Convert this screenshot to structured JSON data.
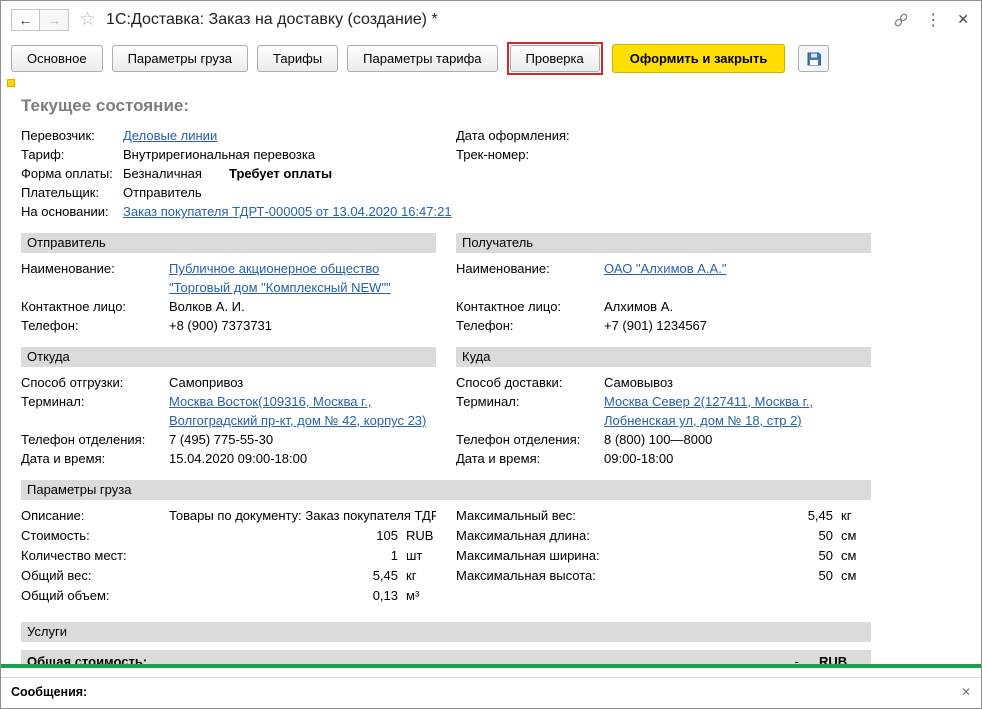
{
  "window": {
    "title": "1С:Доставка: Заказ на доставку (создание) *"
  },
  "tabs": {
    "main": "Основное",
    "cargo": "Параметры груза",
    "tariffs": "Тарифы",
    "tariff_params": "Параметры тарифа",
    "check": "Проверка",
    "submit": "Оформить и закрыть"
  },
  "state": {
    "heading": "Текущее состояние:",
    "carrier_label": "Перевозчик:",
    "carrier_value": "Деловые линии",
    "tariff_label": "Тариф:",
    "tariff_value": "Внутрирегиональная перевозка",
    "payment_label": "Форма оплаты:",
    "payment_value": "Безналичная",
    "payment_status": "Требует оплаты",
    "payer_label": "Плательщик:",
    "payer_value": "Отправитель",
    "basis_label": "На основании:",
    "basis_value": "Заказ покупателя ТДРТ-000005 от 13.04.2020 16:47:21",
    "reg_date_label": "Дата оформления:",
    "track_label": "Трек-номер:"
  },
  "sender": {
    "header": "Отправитель",
    "name_label": "Наименование:",
    "name_value": "Публичное акционерное общество \"Торговый дом \"Комплексный NEW\"\"",
    "contact_label": "Контактное лицо:",
    "contact_value": "Волков А. И.",
    "phone_label": "Телефон:",
    "phone_value": "+8 (900) 7373731"
  },
  "receiver": {
    "header": "Получатель",
    "name_label": "Наименование:",
    "name_value": "ОАО \"Алхимов А.А.\"",
    "contact_label": "Контактное лицо:",
    "contact_value": "Алхимов А.",
    "phone_label": "Телефон:",
    "phone_value": "+7 (901) 1234567"
  },
  "origin": {
    "header": "Откуда",
    "method_label": "Способ отгрузки:",
    "method_value": "Самопривоз",
    "terminal_label": "Терминал:",
    "terminal_value": "Москва Восток(109316, Москва г., Волгоградский пр-кт, дом № 42, корпус 23)",
    "phone_label": "Телефон отделения:",
    "phone_value": "7 (495) 775-55-30",
    "datetime_label": "Дата и время:",
    "datetime_value": "15.04.2020 09:00-18:00"
  },
  "destination": {
    "header": "Куда",
    "method_label": "Способ доставки:",
    "method_value": "Самовывоз",
    "terminal_label": "Терминал:",
    "terminal_value": "Москва Север 2(127411, Москва г., Лобненская ул, дом № 18, стр 2)",
    "phone_label": "Телефон отделения:",
    "phone_value": "8 (800) 100—8000",
    "datetime_label": "Дата и время:",
    "datetime_value": "09:00-18:00"
  },
  "cargo": {
    "header": "Параметры груза",
    "description_label": "Описание:",
    "description_value": "Товары по документу: Заказ покупателя ТДР",
    "cost_label": "Стоимость:",
    "cost_value": "105",
    "cost_unit": "RUB",
    "places_label": "Количество мест:",
    "places_value": "1",
    "places_unit": "шт",
    "weight_label": "Общий вес:",
    "weight_value": "5,45",
    "weight_unit": "кг",
    "volume_label": "Общий объем:",
    "volume_value": "0,13",
    "volume_unit": "м³",
    "max_weight_label": "Максимальный вес:",
    "max_weight_value": "5,45",
    "max_weight_unit": "кг",
    "max_length_label": "Максимальная длина:",
    "max_length_value": "50",
    "max_length_unit": "см",
    "max_width_label": "Максимальная ширина:",
    "max_width_value": "50",
    "max_width_unit": "см",
    "max_height_label": "Максимальная высота:",
    "max_height_value": "50",
    "max_height_unit": "см"
  },
  "services": {
    "header": "Услуги"
  },
  "total": {
    "label": "Общая стоимость:",
    "value": "-",
    "unit": "RUB"
  },
  "messages": {
    "label": "Сообщения:"
  },
  "colors": {
    "accent_yellow": "#FFDF00",
    "check_highlight_red": "#CF2A27",
    "link_blue": "#2861A8",
    "section_header_gray": "#DBDBDB",
    "status_green_bar": "#16A34A",
    "heading_gray": "#7E7E7E"
  }
}
